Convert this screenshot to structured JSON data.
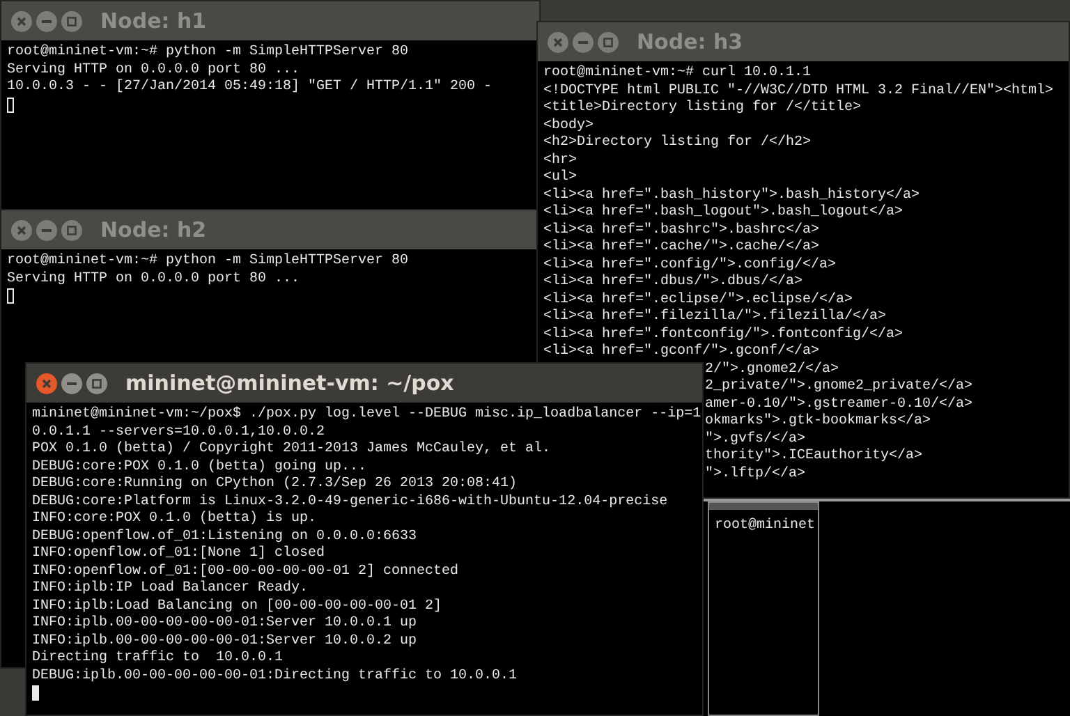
{
  "windows": [
    {
      "kind": "terminal",
      "title": "Node: h1",
      "focused": false,
      "lines": [
        "root@mininet-vm:~# python -m SimpleHTTPServer 80",
        "Serving HTTP on 0.0.0.0 port 80 ...",
        "10.0.0.3 - - [27/Jan/2014 05:49:18] \"GET / HTTP/1.1\" 200 -"
      ]
    },
    {
      "kind": "terminal",
      "title": "Node: h2",
      "focused": false,
      "lines": [
        "root@mininet-vm:~# python -m SimpleHTTPServer 80",
        "Serving HTTP on 0.0.0.0 port 80 ..."
      ]
    },
    {
      "kind": "terminal",
      "title": "Node: h3",
      "focused": false,
      "lines": [
        "root@mininet-vm:~# curl 10.0.1.1",
        "<!DOCTYPE html PUBLIC \"-//W3C//DTD HTML 3.2 Final//EN\"><html>",
        "<title>Directory listing for /</title>",
        "<body>",
        "<h2>Directory listing for /</h2>",
        "<hr>",
        "<ul>",
        "<li><a href=\".bash_history\">.bash_history</a>",
        "<li><a href=\".bash_logout\">.bash_logout</a>",
        "<li><a href=\".bashrc\">.bashrc</a>",
        "<li><a href=\".cache/\">.cache/</a>",
        "<li><a href=\".config/\">.config/</a>",
        "<li><a href=\".dbus/\">.dbus/</a>",
        "<li><a href=\".eclipse/\">.eclipse/</a>",
        "<li><a href=\".filezilla/\">.filezilla/</a>",
        "<li><a href=\".fontconfig/\">.fontconfig/</a>",
        "<li><a href=\".gconf/\">.gconf/</a>"
      ],
      "lines_partly_covered": [
        "2/\">.gnome2/</a>",
        "2_private/\">.gnome2_private/</a>",
        "amer-0.10/\">.gstreamer-0.10/</a>",
        "okmarks\">.gtk-bookmarks</a>",
        "\">.gvfs/</a>",
        "thority\">.ICEauthority</a>",
        "\">.lftp/</a>"
      ]
    },
    {
      "kind": "terminal",
      "title": "mininet@mininet-vm: ~/pox",
      "focused": true,
      "lines": [
        "mininet@mininet-vm:~/pox$ ./pox.py log.level --DEBUG misc.ip_loadbalancer --ip=1",
        "0.0.1.1 --servers=10.0.0.1,10.0.0.2",
        "POX 0.1.0 (betta) / Copyright 2011-2013 James McCauley, et al.",
        "DEBUG:core:POX 0.1.0 (betta) going up...",
        "DEBUG:core:Running on CPython (2.7.3/Sep 26 2013 20:08:41)",
        "DEBUG:core:Platform is Linux-3.2.0-49-generic-i686-with-Ubuntu-12.04-precise",
        "INFO:core:POX 0.1.0 (betta) is up.",
        "DEBUG:openflow.of_01:Listening on 0.0.0.0:6633",
        "INFO:openflow.of_01:[None 1] closed",
        "INFO:openflow.of_01:[00-00-00-00-00-01 2] connected",
        "INFO:iplb:IP Load Balancer Ready.",
        "INFO:iplb:Load Balancing on [00-00-00-00-00-01 2]",
        "INFO:iplb.00-00-00-00-00-01:Server 10.0.0.1 up",
        "INFO:iplb.00-00-00-00-00-01:Server 10.0.0.2 up",
        "Directing traffic to  10.0.0.1",
        "DEBUG:iplb.00-00-00-00-00-01:Directing traffic to 10.0.0.1"
      ]
    },
    {
      "kind": "small",
      "lines": [
        "root@mininet"
      ]
    }
  ]
}
